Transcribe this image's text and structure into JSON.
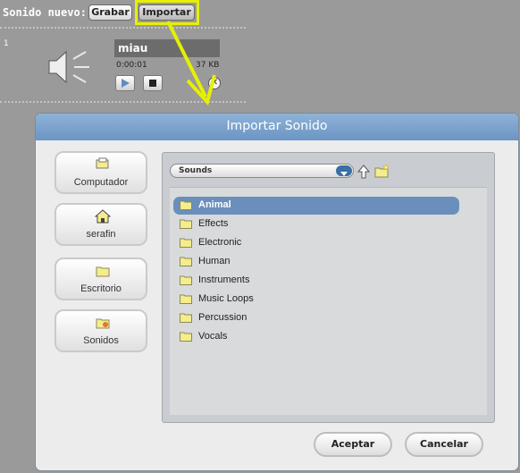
{
  "toolbar": {
    "new_sound_label": "Sonido nuevo:",
    "record_label": "Grabar",
    "import_label": "Importar"
  },
  "sound_item": {
    "index": "1",
    "name": "miau",
    "duration": "0:00:01",
    "size": "37 KB"
  },
  "dialog": {
    "title": "Importar Sonido",
    "places": [
      {
        "label": "Computador",
        "icon": "computer-icon"
      },
      {
        "label": "serafin",
        "icon": "home-icon"
      },
      {
        "label": "Escritorio",
        "icon": "desktop-folder-icon"
      },
      {
        "label": "Sonidos",
        "icon": "sounds-folder-icon"
      }
    ],
    "path": "Sounds",
    "files": [
      {
        "label": "Animal",
        "selected": true
      },
      {
        "label": "Effects"
      },
      {
        "label": "Electronic"
      },
      {
        "label": "Human"
      },
      {
        "label": "Instruments"
      },
      {
        "label": "Music Loops"
      },
      {
        "label": "Percussion"
      },
      {
        "label": "Vocals"
      }
    ],
    "accept_label": "Aceptar",
    "cancel_label": "Cancelar"
  },
  "colors": {
    "highlight": "#e6f000",
    "title_bar": "#7aa3cf",
    "selected_row": "#6a8fbc",
    "folder": "#f5ec8c"
  }
}
